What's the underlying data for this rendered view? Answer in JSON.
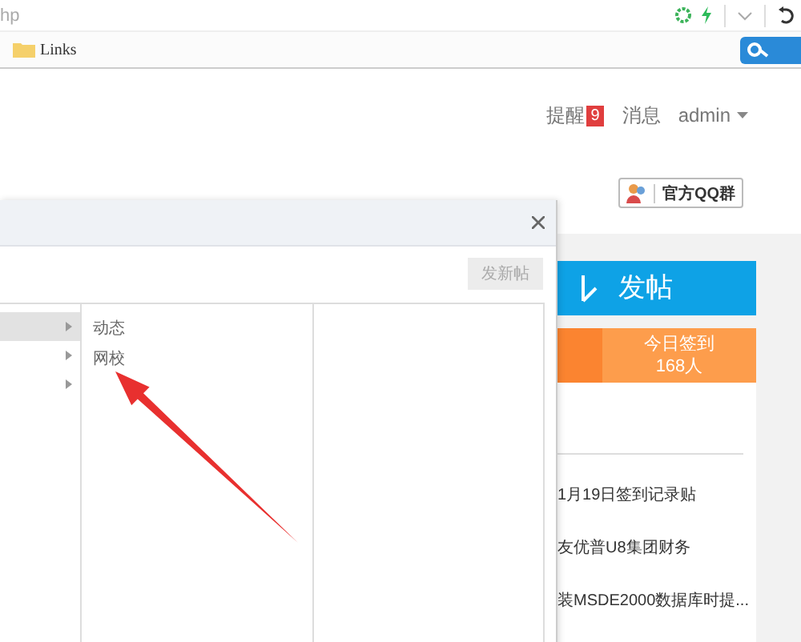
{
  "browser": {
    "address": "hp",
    "bookmarks": [
      {
        "label": "Links"
      }
    ]
  },
  "header": {
    "notifications": {
      "label": "提醒",
      "badge": "9"
    },
    "messages": "消息",
    "user": {
      "name": "admin",
      "dropdown": true
    }
  },
  "qq_button": "官方QQ群",
  "dialog": {
    "new_post_button": "发新帖",
    "categories": [
      {
        "selected": true
      },
      {
        "selected": false
      },
      {
        "selected": false
      }
    ],
    "subcategories": [
      {
        "label": "动态"
      },
      {
        "label": "网校"
      }
    ]
  },
  "sidebar": {
    "post_button": "发帖",
    "checkin": {
      "label": "今日签到",
      "count": "168人"
    },
    "posts": [
      {
        "title": "1月19日签到记录贴"
      },
      {
        "title": "友优普U8集团财务"
      },
      {
        "title": "装MSDE2000数据库时提..."
      }
    ]
  }
}
